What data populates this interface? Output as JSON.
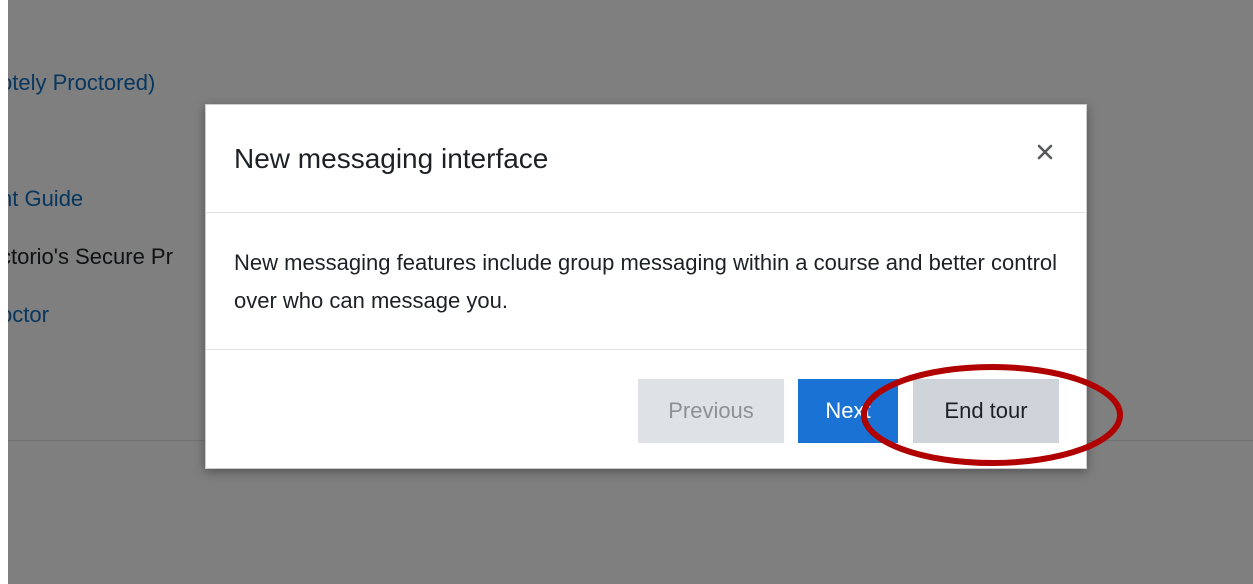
{
  "background": {
    "link_1": "otely Proctored)",
    "link_2": "nt Guide",
    "text_3": "ctorio's Secure Pr",
    "link_4": "octor"
  },
  "modal": {
    "title": "New messaging interface",
    "close_icon": "close-icon",
    "body": "New messaging features include group messaging within a course and better control over who can message you.",
    "buttons": {
      "previous": "Previous",
      "next": "Next",
      "end_tour": "End tour"
    }
  },
  "colors": {
    "accent": "#1a73d4",
    "annotation": "#b00000",
    "link": "#0f6cbf"
  }
}
